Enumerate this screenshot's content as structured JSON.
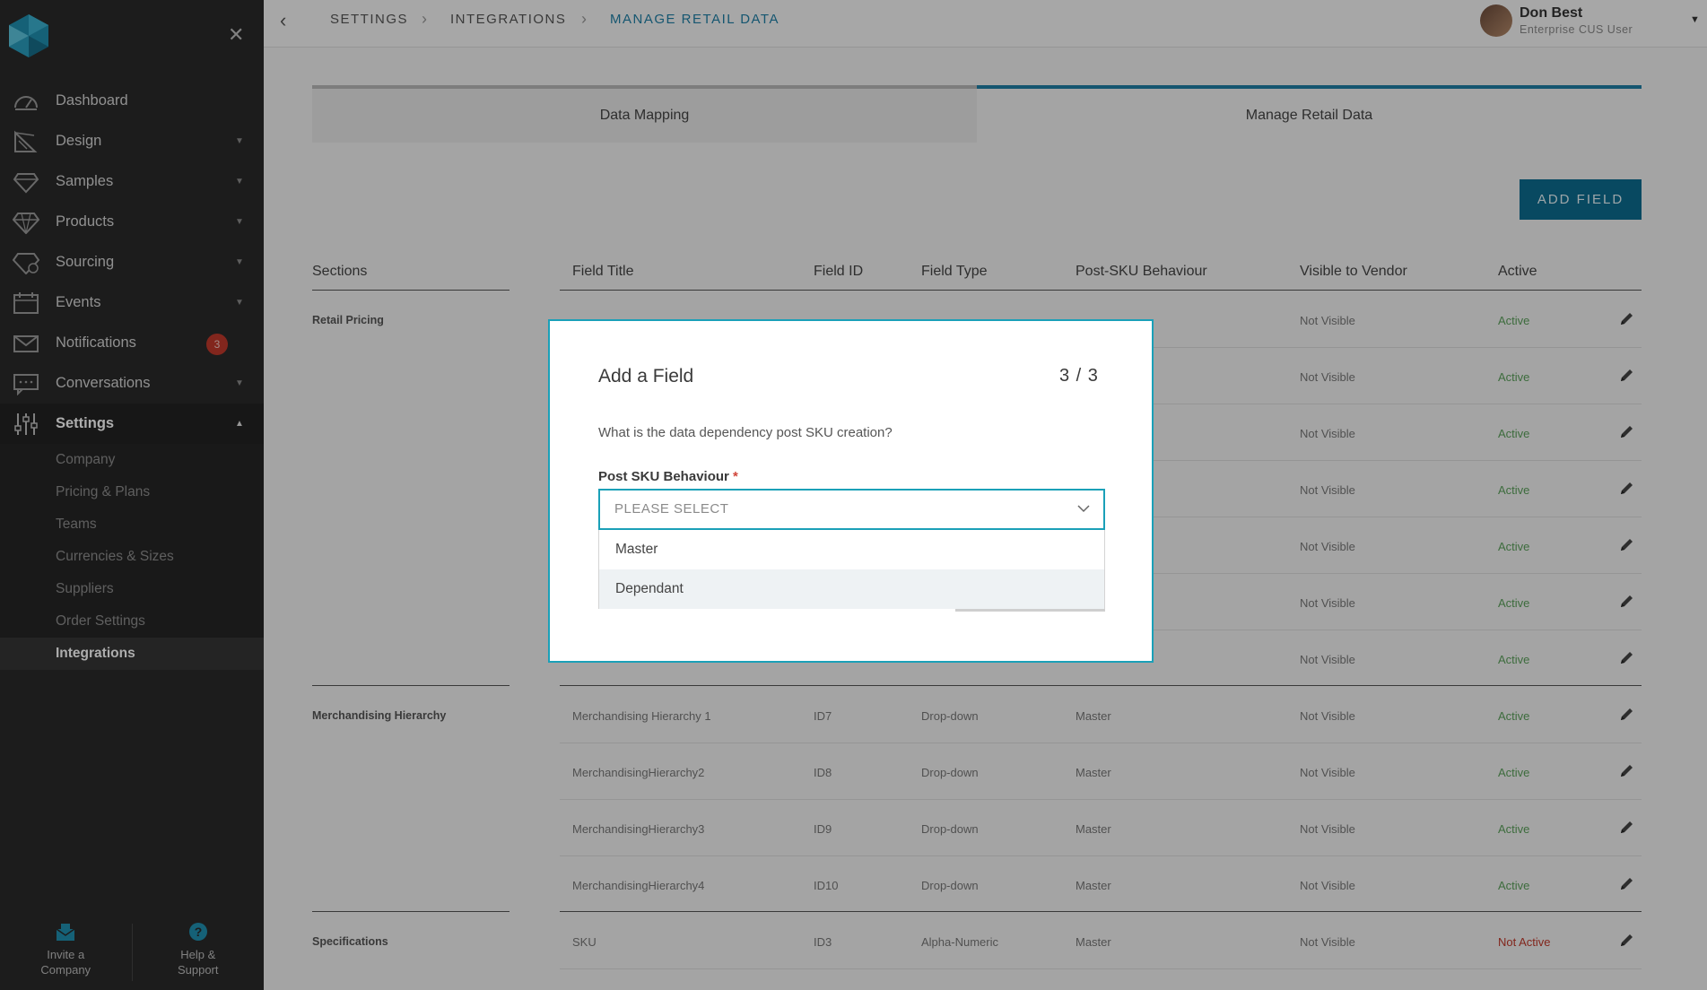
{
  "sidebar": {
    "close_icon": "close-icon",
    "items": [
      {
        "label": "Dashboard",
        "icon": "dashboard-icon",
        "has_arrow": false
      },
      {
        "label": "Design",
        "icon": "design-icon",
        "has_arrow": true
      },
      {
        "label": "Samples",
        "icon": "gem-icon",
        "has_arrow": true
      },
      {
        "label": "Products",
        "icon": "diamond-icon",
        "has_arrow": true
      },
      {
        "label": "Sourcing",
        "icon": "sourcing-icon",
        "has_arrow": true
      },
      {
        "label": "Events",
        "icon": "calendar-icon",
        "has_arrow": true
      },
      {
        "label": "Notifications",
        "icon": "envelope-icon",
        "badge": "3"
      },
      {
        "label": "Conversations",
        "icon": "chat-icon",
        "has_arrow": true
      },
      {
        "label": "Settings",
        "icon": "sliders-icon",
        "expanded": true
      }
    ],
    "settings_sub": [
      "Company",
      "Pricing & Plans",
      "Teams",
      "Currencies & Sizes",
      "Suppliers",
      "Order Settings",
      "Integrations"
    ],
    "footer": {
      "invite": "Invite a\nCompany",
      "help": "Help &\nSupport"
    },
    "colors": {
      "background": "#2a2a2a",
      "badge": "#c0392b"
    }
  },
  "topbar": {
    "breadcrumb": [
      "SETTINGS",
      "INTEGRATIONS",
      "MANAGE RETAIL DATA"
    ],
    "user_name": "Don Best",
    "user_role": "Enterprise CUS User"
  },
  "tabs": [
    "Data Mapping",
    "Manage Retail Data"
  ],
  "add_field_button": "ADD FIELD",
  "table": {
    "headers": [
      "Sections",
      "Field Title",
      "Field ID",
      "Field Type",
      "Post-SKU Behaviour",
      "Visible to Vendor",
      "Active"
    ],
    "sections": {
      "retail_pricing": "Retail Pricing",
      "merch": "Merchandising Hierarchy",
      "specs": "Specifications"
    },
    "retail_rows": [
      {
        "vis": "Not Visible",
        "active": "Active"
      },
      {
        "vis": "Not Visible",
        "active": "Active"
      },
      {
        "vis": "Not Visible",
        "active": "Active"
      },
      {
        "vis": "Not Visible",
        "active": "Active"
      },
      {
        "vis": "Not Visible",
        "active": "Active"
      },
      {
        "vis": "Not Visible",
        "active": "Active"
      },
      {
        "vis": "Not Visible",
        "active": "Active"
      }
    ],
    "merch_rows": [
      {
        "title": "Merchandising Hierarchy 1",
        "id": "ID7",
        "type": "Drop-down",
        "behaviour": "Master",
        "vis": "Not Visible",
        "active": "Active"
      },
      {
        "title": "MerchandisingHierarchy2",
        "id": "ID8",
        "type": "Drop-down",
        "behaviour": "Master",
        "vis": "Not Visible",
        "active": "Active"
      },
      {
        "title": "MerchandisingHierarchy3",
        "id": "ID9",
        "type": "Drop-down",
        "behaviour": "Master",
        "vis": "Not Visible",
        "active": "Active"
      },
      {
        "title": "MerchandisingHierarchy4",
        "id": "ID10",
        "type": "Drop-down",
        "behaviour": "Master",
        "vis": "Not Visible",
        "active": "Active"
      }
    ],
    "spec_rows": [
      {
        "title": "SKU",
        "id": "ID3",
        "type": "Alpha-Numeric",
        "behaviour": "Master",
        "vis": "Not Visible",
        "active": "Not Active"
      }
    ]
  },
  "modal": {
    "title": "Add a Field",
    "step": "3 / 3",
    "question": "What is the data dependency post SKU creation?",
    "field_label": "Post SKU Behaviour",
    "required_mark": "*",
    "placeholder": "PLEASE SELECT",
    "options": [
      "Master",
      "Dependant"
    ],
    "hovered_option": "Dependant",
    "accent": "#1aa0b8"
  },
  "colors": {
    "accent": "#1f7fa6",
    "button": "#0d6c8f",
    "active_status": "#5aa05a",
    "inactive_status": "#c0392b"
  }
}
